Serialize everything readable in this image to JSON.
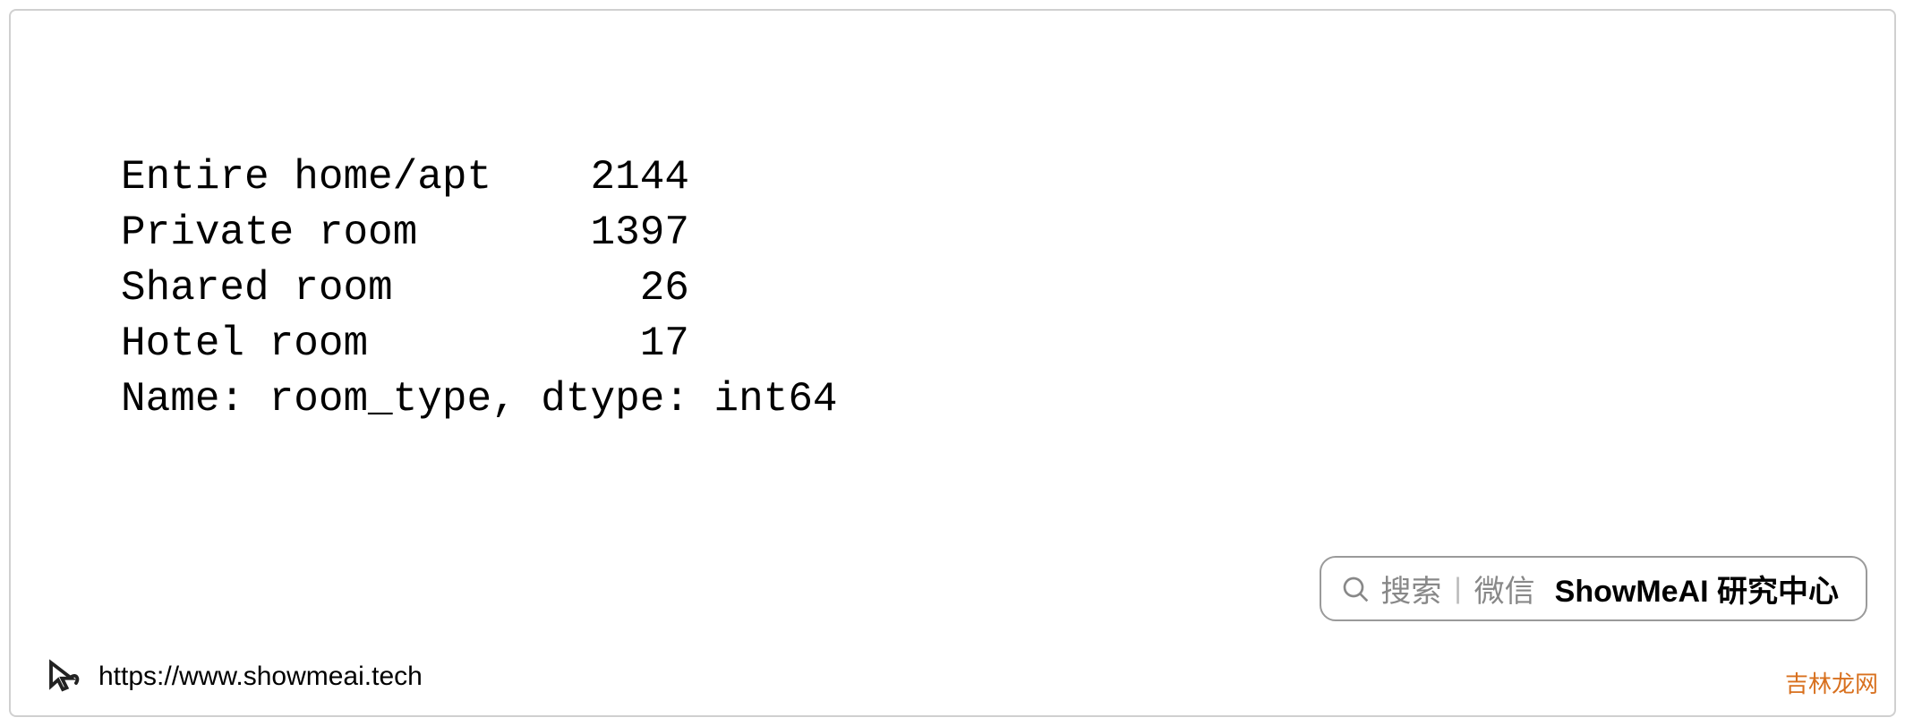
{
  "output": {
    "rows": [
      {
        "label": "Entire home/apt",
        "value": 2144
      },
      {
        "label": "Private room",
        "value": 1397
      },
      {
        "label": "Shared room",
        "value": 26
      },
      {
        "label": "Hotel room",
        "value": 17
      }
    ],
    "meta_line": "Name: room_type, dtype: int64",
    "name": "room_type",
    "dtype": "int64"
  },
  "badge": {
    "search": "搜索",
    "wechat": "微信",
    "brand": "ShowMeAI 研究中心"
  },
  "footer": {
    "url": "https://www.showmeai.tech"
  },
  "source": "吉林龙网"
}
